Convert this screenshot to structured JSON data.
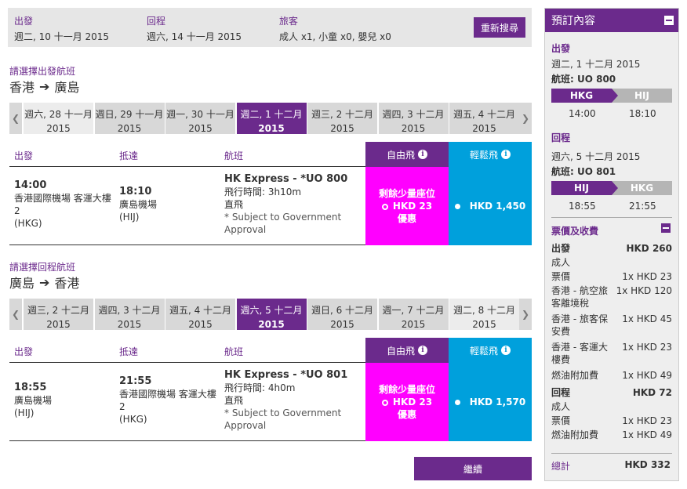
{
  "search": {
    "depart_label": "出發",
    "depart_value": "週二, 10 十一月 2015",
    "return_label": "回程",
    "return_value": "週六, 14 十一月 2015",
    "pax_label": "旅客",
    "pax_value": "成人 x1, 小童 x0, 嬰兒 x0",
    "research_button": "重新搜尋"
  },
  "outbound": {
    "section_label": "請選擇出發航班",
    "from": "香港",
    "to": "廣島",
    "dates": [
      {
        "day": "週六, 28 十一月",
        "year": "2015",
        "state": "light"
      },
      {
        "day": "週日, 29 十一月",
        "year": "2015",
        "state": "normal"
      },
      {
        "day": "週一, 30 十一月",
        "year": "2015",
        "state": "normal"
      },
      {
        "day": "週二, 1 十二月",
        "year": "2015",
        "state": "active"
      },
      {
        "day": "週三, 2 十二月",
        "year": "2015",
        "state": "normal"
      },
      {
        "day": "週四, 3 十二月",
        "year": "2015",
        "state": "normal"
      },
      {
        "day": "週五, 4 十二月",
        "year": "2015",
        "state": "normal"
      }
    ],
    "headers": {
      "depart": "出發",
      "arrive": "抵達",
      "flight": "航班",
      "free_fare": "自由飛",
      "easy_fare": "輕鬆飛"
    },
    "flight": {
      "dep_time": "14:00",
      "dep_place": "香港國際機場 客運大樓 2",
      "dep_code": "(HKG)",
      "arr_time": "18:10",
      "arr_place": "廣島機場",
      "arr_code": "(HIJ)",
      "flight_name": "HK Express - *UO 800",
      "duration": "飛行時間: 3h10m",
      "stops": "直飛",
      "note": "* Subject to Government Approval",
      "free_line1": "剩餘少量座位",
      "free_price": "HKD 23",
      "free_line3": "優惠",
      "easy_price": "HKD 1,450"
    }
  },
  "inbound": {
    "section_label": "請選擇回程航班",
    "from": "廣島",
    "to": "香港",
    "dates": [
      {
        "day": "週三, 2 十二月",
        "year": "2015",
        "state": "normal"
      },
      {
        "day": "週四, 3 十二月",
        "year": "2015",
        "state": "normal"
      },
      {
        "day": "週五, 4 十二月",
        "year": "2015",
        "state": "normal"
      },
      {
        "day": "週六, 5 十二月",
        "year": "2015",
        "state": "active"
      },
      {
        "day": "週日, 6 十二月",
        "year": "2015",
        "state": "normal"
      },
      {
        "day": "週一, 7 十二月",
        "year": "2015",
        "state": "normal"
      },
      {
        "day": "週二, 8 十二月",
        "year": "2015",
        "state": "light"
      }
    ],
    "headers": {
      "depart": "出發",
      "arrive": "抵達",
      "flight": "航班",
      "free_fare": "自由飛",
      "easy_fare": "輕鬆飛"
    },
    "flight": {
      "dep_time": "18:55",
      "dep_place": "廣島機場",
      "dep_code": "(HIJ)",
      "arr_time": "21:55",
      "arr_place": "香港國際機場 客運大樓 2",
      "arr_code": "(HKG)",
      "flight_name": "HK Express - *UO 801",
      "duration": "飛行時間: 4h0m",
      "stops": "直飛",
      "note": "* Subject to Government Approval",
      "free_line1": "剩餘少量座位",
      "free_price": "HKD 23",
      "free_line3": "優惠",
      "easy_price": "HKD 1,570"
    }
  },
  "continue_button": "繼續",
  "panel": {
    "title": "預訂內容",
    "out_label": "出發",
    "out_date": "週二, 1 十二月 2015",
    "out_flight": "航班: UO 800",
    "out_from": "HKG",
    "out_to": "HIJ",
    "out_dep": "14:00",
    "out_arr": "18:10",
    "ret_label": "回程",
    "ret_date": "週六, 5 十二月 2015",
    "ret_flight": "航班: UO 801",
    "ret_from": "HIJ",
    "ret_to": "HKG",
    "ret_dep": "18:55",
    "ret_arr": "21:55",
    "fees_title": "票價及收費",
    "out_fees": {
      "label": "出發",
      "total": "HKD 260",
      "items": [
        {
          "name": "成人",
          "amount": ""
        },
        {
          "name": "票價",
          "amount": "1x HKD 23"
        },
        {
          "name": "香港 - 航空旅客離境稅",
          "amount": "1x HKD 120"
        },
        {
          "name": "香港 - 旅客保安費",
          "amount": "1x HKD 45"
        },
        {
          "name": "香港 - 客運大樓費",
          "amount": "1x HKD 23"
        },
        {
          "name": "燃油附加費",
          "amount": "1x HKD 49"
        }
      ]
    },
    "ret_fees": {
      "label": "回程",
      "total": "HKD 72",
      "items": [
        {
          "name": "成人",
          "amount": ""
        },
        {
          "name": "票價",
          "amount": "1x HKD 23"
        },
        {
          "name": "燃油附加費",
          "amount": "1x HKD 49"
        }
      ]
    },
    "grand_label": "總計",
    "grand_total": "HKD 332"
  }
}
